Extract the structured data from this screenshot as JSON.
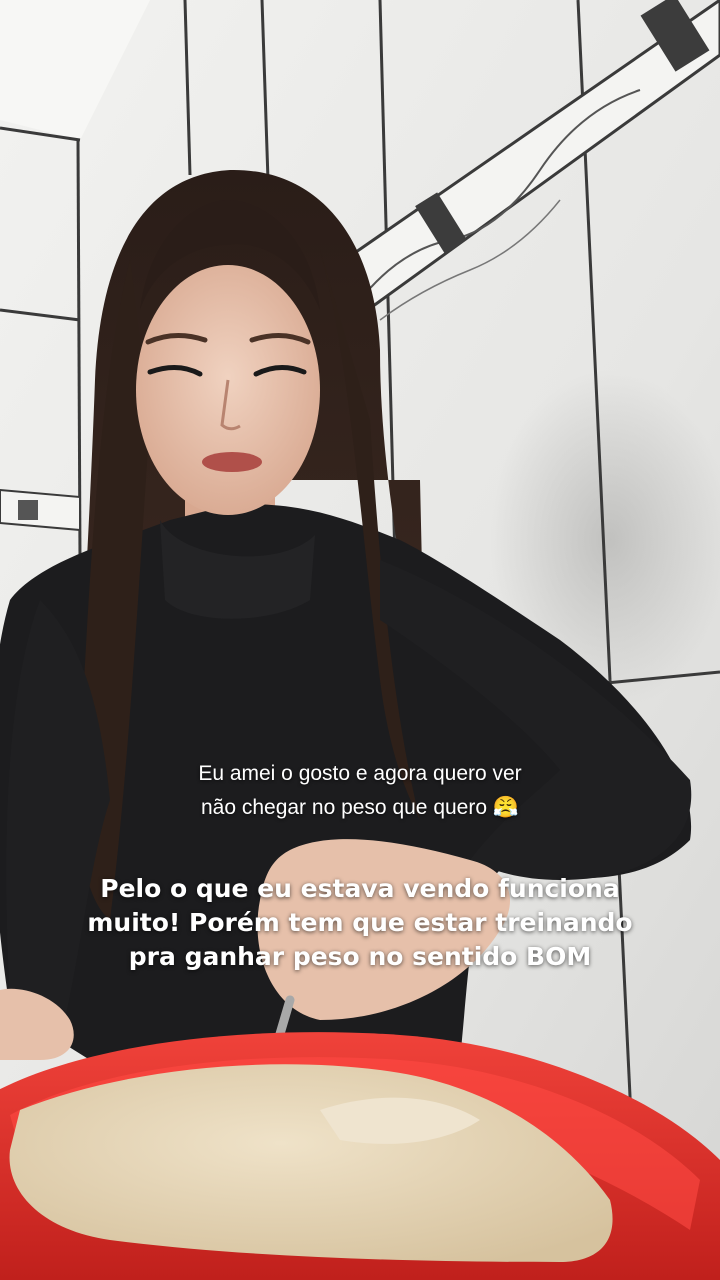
{
  "overlay": {
    "top_caption_line1": "Eu amei o gosto e agora quero ver",
    "top_caption_line2": "não chegar no peso que quero 😤",
    "main_caption_line1": "Pelo o que eu estava vendo funciona",
    "main_caption_line2": "muito! Porém tem que estar treinando",
    "main_caption_line3": "pra ganhar peso no sentido BOM"
  },
  "colors": {
    "tile": "#eeeeec",
    "grout": "#3a3a3a",
    "sweater": "#1c1c1e",
    "hair": "#2a1d18",
    "bowl": "#e0302a",
    "flour": "#e2d2b4"
  }
}
